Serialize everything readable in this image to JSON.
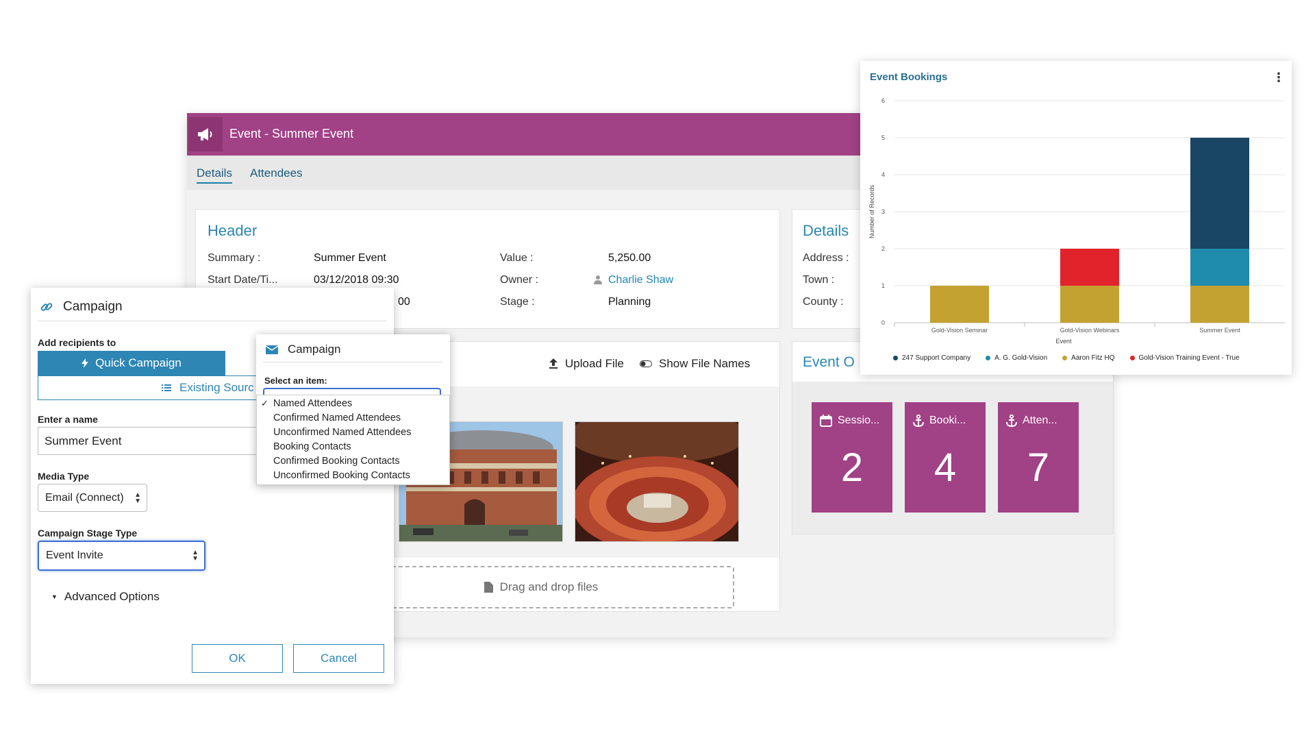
{
  "event": {
    "title": "Event - Summer Event",
    "tabs": [
      {
        "label": "Details"
      },
      {
        "label": "Attendees"
      }
    ],
    "header_card": {
      "title": "Header",
      "summary_label": "Summary :",
      "summary_value": "Summer Event",
      "start_label": "Start Date/Ti...",
      "start_value": "03/12/2018 09:30",
      "end_value_partial": "00",
      "value_label": "Value :",
      "value_value": "5,250.00",
      "owner_label": "Owner :",
      "owner_value": "Charlie Shaw",
      "stage_label": "Stage :",
      "stage_value": "Planning"
    },
    "details_card": {
      "title": "Details",
      "address_label": "Address :",
      "town_label": "Town :",
      "county_label": "County :"
    },
    "files": {
      "upload_label": "Upload File",
      "show_names_label": "Show File Names",
      "drop_label": "Drag and drop files"
    },
    "overview": {
      "title": "Event O",
      "tiles": [
        {
          "label": "Sessio...",
          "value": "2",
          "icon": "calendar-icon"
        },
        {
          "label": "Booki...",
          "value": "4",
          "icon": "anchor-icon"
        },
        {
          "label": "Atten...",
          "value": "7",
          "icon": "anchor-icon"
        }
      ]
    }
  },
  "campaign_dialog": {
    "title": "Campaign",
    "add_recipients_label": "Add recipients to",
    "quick_campaign_label": "Quick Campaign",
    "existing_source_label": "Existing Sourc",
    "name_label": "Enter a name",
    "name_value": "Summer Event",
    "media_type_label": "Media Type",
    "media_type_value": "Email (Connect)",
    "stage_type_label": "Campaign Stage Type",
    "stage_type_value": "Event Invite",
    "advanced_label": "Advanced Options",
    "ok_label": "OK",
    "cancel_label": "Cancel"
  },
  "select_popup": {
    "title": "Campaign",
    "select_label": "Select an item:",
    "options": [
      {
        "label": "Named Attendees",
        "selected": true
      },
      {
        "label": "Confirmed Named Attendees",
        "selected": false
      },
      {
        "label": "Unconfirmed Named Attendees",
        "selected": false
      },
      {
        "label": "Booking Contacts",
        "selected": false
      },
      {
        "label": "Confirmed Booking Contacts",
        "selected": false
      },
      {
        "label": "Unconfirmed Booking Contacts",
        "selected": false
      }
    ]
  },
  "colors": {
    "brand_purple": "#a14186",
    "accent_blue": "#2d86b4"
  },
  "chart_data": {
    "type": "bar",
    "stacked": true,
    "title": "Event Bookings",
    "xlabel": "Event",
    "ylabel": "Number of Records",
    "ylim": [
      0,
      6
    ],
    "yticks": [
      0,
      1,
      2,
      3,
      4,
      5,
      6
    ],
    "categories": [
      "Gold-Vision Seminar",
      "Gold-Vision Webinars",
      "Summer Event"
    ],
    "series": [
      {
        "name": "Aaron Fitz HQ",
        "color": "#c4a232",
        "values": [
          1,
          1,
          1
        ]
      },
      {
        "name": "Gold-Vision Training Event - True",
        "color": "#e1242b",
        "values": [
          0,
          1,
          0
        ]
      },
      {
        "name": "A. G. Gold-Vision",
        "color": "#1f8bad",
        "values": [
          0,
          0,
          1
        ]
      },
      {
        "name": "247 Support Company",
        "color": "#1a4665",
        "values": [
          0,
          0,
          3
        ]
      }
    ],
    "legend_order": [
      "247 Support Company",
      "A. G. Gold-Vision",
      "Aaron Fitz HQ",
      "Gold-Vision Training Event - True"
    ],
    "grid": true,
    "legend_position": "bottom"
  }
}
